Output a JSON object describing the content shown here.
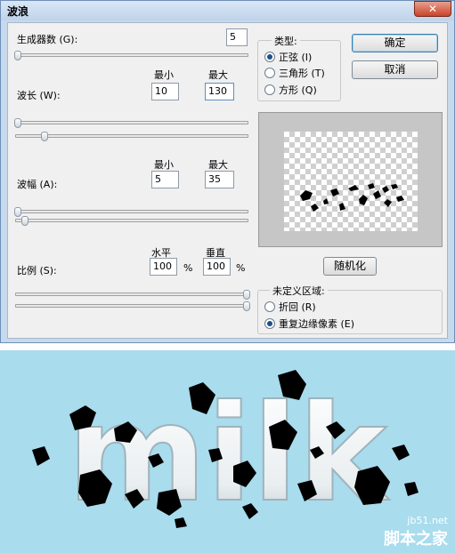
{
  "dialog": {
    "title": "波浪",
    "generators": {
      "label": "生成器数 (G):",
      "value": "5"
    },
    "column_min": "最小",
    "column_max": "最大",
    "wavelength": {
      "label": "波长 (W):",
      "min": "10",
      "max": "130"
    },
    "amplitude": {
      "label": "波幅 (A):",
      "min": "5",
      "max": "35"
    },
    "scale": {
      "label": "比例 (S):",
      "col_h": "水平",
      "col_v": "垂直",
      "horizontal": "100",
      "vertical": "100",
      "unit": "%"
    },
    "type_group": {
      "title": "类型:",
      "options": [
        {
          "label": "正弦 (I)",
          "selected": true
        },
        {
          "label": "三角形 (T)",
          "selected": false
        },
        {
          "label": "方形 (Q)",
          "selected": false
        }
      ]
    },
    "ok_label": "确定",
    "cancel_label": "取消",
    "randomize_label": "随机化",
    "undefined_group": {
      "title": "未定义区域:",
      "options": [
        {
          "label": "折回 (R)",
          "selected": false
        },
        {
          "label": "重复边缘像素 (E)",
          "selected": true
        }
      ]
    },
    "close_label": "✕"
  },
  "artwork": {
    "text": "milk",
    "background_color": "#a9dced",
    "watermark_url": "jb51.net",
    "watermark_name": "脚本之家"
  }
}
